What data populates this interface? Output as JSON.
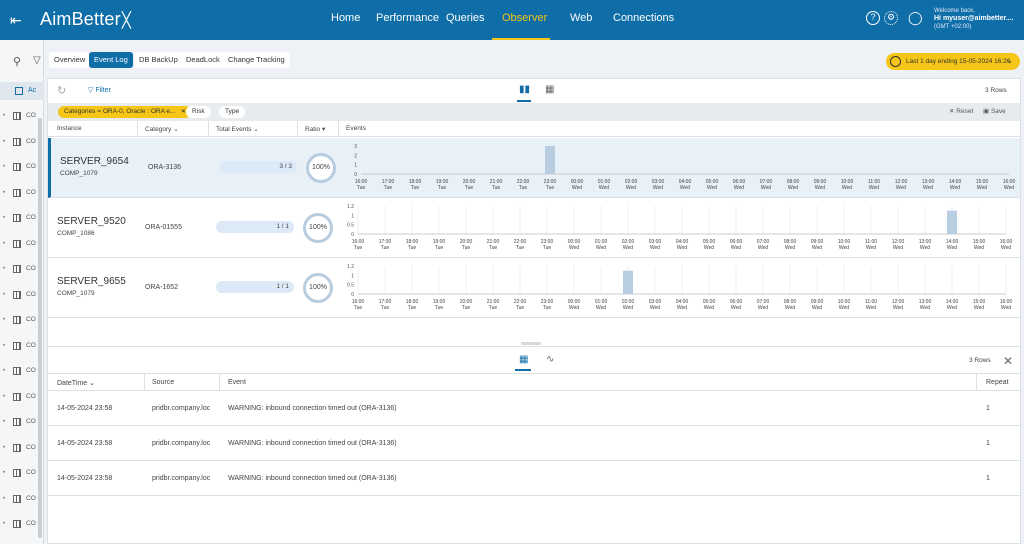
{
  "topbar": {
    "logo": "AimBetter",
    "nav": [
      "Home",
      "Performance",
      "Queries",
      "Observer",
      "Web",
      "Connections"
    ],
    "active_nav": "Observer",
    "welcome": "Welcome back,",
    "user": "Hi myuser@aimbetter....",
    "timezone": "(GMT +02:00)"
  },
  "sidebar": {
    "active_label": "Ac",
    "item_label": "CO"
  },
  "tabs": [
    "Overview",
    "Event Log",
    "DB BackUp",
    "DeadLock",
    "Change Tracking"
  ],
  "active_tab": "Event Log",
  "time_range": "Last 1 day ending  15-05-2024 16:26",
  "toolbar": {
    "filter_label": "Filter",
    "rows": "3 Rows",
    "chip_categories": "Categories = ORA-0, Oracle : ORA e...",
    "chip_risk": "Risk",
    "chip_type": "Type",
    "reset": "Reset",
    "save": "Save"
  },
  "table": {
    "headers": [
      "Instance",
      "Category",
      "Total Events",
      "Ratio",
      "Events"
    ],
    "rows": [
      {
        "instance": "SERVER_9654",
        "company": "COMP_1079",
        "category": "ORA-3136",
        "events": "3 / 3",
        "ratio": "100%",
        "ymax": 3,
        "yticks": [
          "3",
          "2",
          "1",
          "0"
        ],
        "spike_index": 7,
        "spike_value": 3
      },
      {
        "instance": "SERVER_9520",
        "company": "COMP_1086",
        "category": "ORA-01555",
        "events": "1 / 1",
        "ratio": "100%",
        "ymax": 1.2,
        "yticks": [
          "1.2",
          "1",
          "0.5",
          "0"
        ],
        "spike_index": 22,
        "spike_value": 1
      },
      {
        "instance": "SERVER_9655",
        "company": "COMP_1079",
        "category": "ORA-1652",
        "events": "1 / 1",
        "ratio": "100%",
        "ymax": 1.2,
        "yticks": [
          "1.2",
          "1",
          "0.5",
          "0"
        ],
        "spike_index": 10,
        "spike_value": 1
      }
    ]
  },
  "hours": [
    "16:00",
    "17:00",
    "18:00",
    "19:00",
    "20:00",
    "21:00",
    "22:00",
    "23:00",
    "00:00",
    "01:00",
    "02:00",
    "03:00",
    "04:00",
    "05:00",
    "06:00",
    "07:00",
    "08:00",
    "09:00",
    "10:00",
    "11:00",
    "12:00",
    "13:00",
    "14:00",
    "15:00",
    "16:00"
  ],
  "days": [
    "Tue",
    "Tue",
    "Tue",
    "Tue",
    "Tue",
    "Tue",
    "Tue",
    "Tue",
    "Wed",
    "Wed",
    "Wed",
    "Wed",
    "Wed",
    "Wed",
    "Wed",
    "Wed",
    "Wed",
    "Wed",
    "Wed",
    "Wed",
    "Wed",
    "Wed",
    "Wed",
    "Wed",
    "Wed"
  ],
  "log": {
    "rows_label": "3 Rows",
    "headers": [
      "DateTime",
      "Source",
      "Event",
      "Repeat"
    ],
    "rows": [
      {
        "datetime": "14-05-2024 23:58",
        "source": "pridbr.company.loc",
        "event": "WARNING: inbound connection timed out (ORA-3136)",
        "repeat": "1"
      },
      {
        "datetime": "14-05-2024 23:58",
        "source": "pridbr.company.loc",
        "event": "WARNING: inbound connection timed out (ORA-3136)",
        "repeat": "1"
      },
      {
        "datetime": "14-05-2024 23:58",
        "source": "pridbr.company.loc",
        "event": "WARNING: inbound connection timed out (ORA-3136)",
        "repeat": "1"
      }
    ]
  },
  "colors": {
    "brand": "#0f6da8",
    "accent": "#f5c518",
    "bar": "#b8cde0"
  }
}
